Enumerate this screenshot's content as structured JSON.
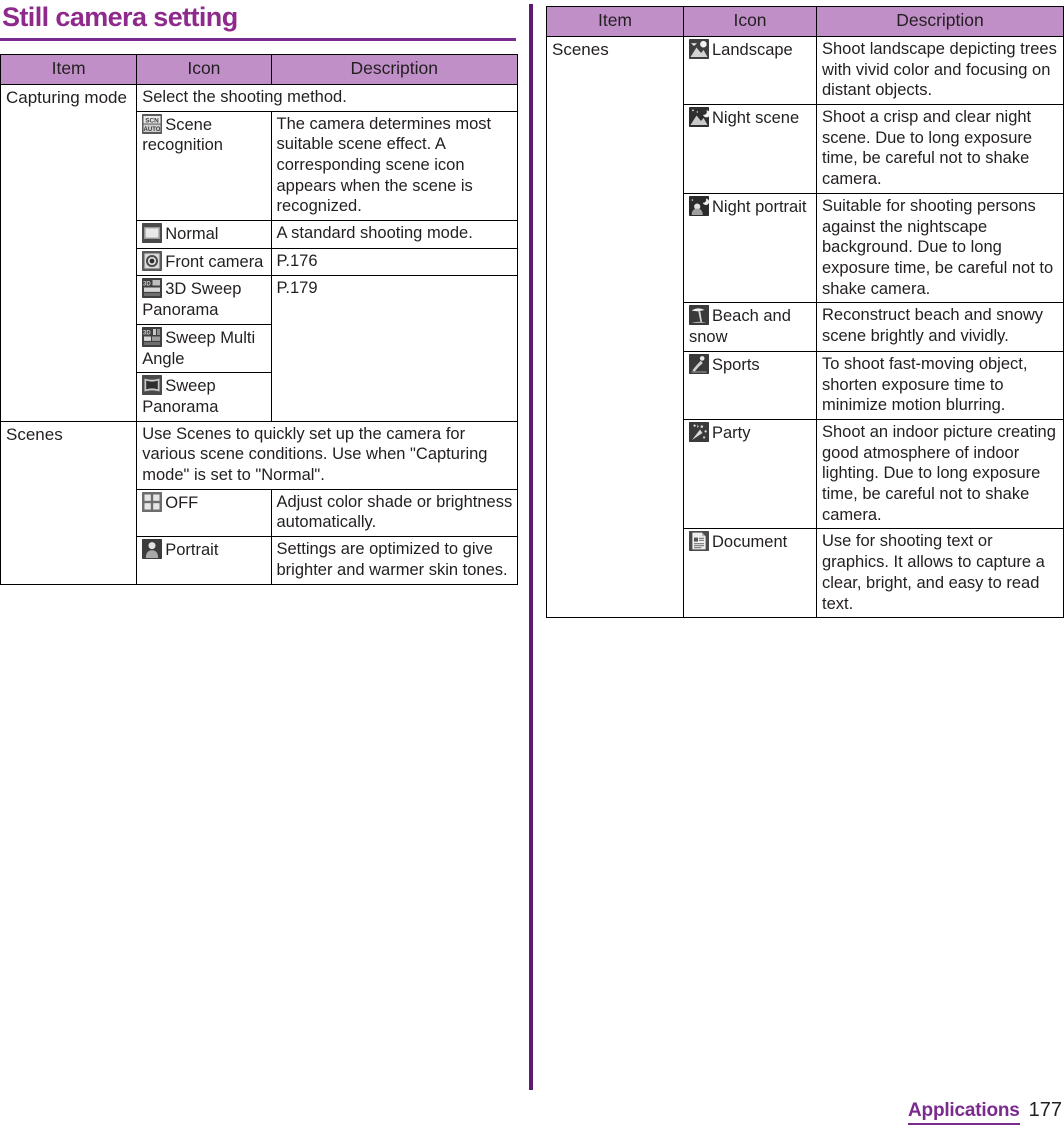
{
  "page": {
    "title": "Still camera setting",
    "footer_section": "Applications",
    "footer_page": "177",
    "accent_color": "#8e2a8b",
    "header_fill": "#c08fc8",
    "rule_color": "#5c1a70"
  },
  "left_table": {
    "headers": [
      "Item",
      "Icon",
      "Description"
    ],
    "rows": [
      {
        "item": "Capturing mode",
        "intro": "Select the shooting method.",
        "entries": [
          {
            "icon_name": "scene-recognition-icon",
            "icon_label": "Scene recognition",
            "description": "The camera determines most suitable scene effect. A corresponding scene icon appears when the scene is recognized."
          },
          {
            "icon_name": "normal-mode-icon",
            "icon_label": "Normal",
            "description": "A standard shooting mode."
          },
          {
            "icon_name": "front-camera-icon",
            "icon_label": "Front camera",
            "description": "P.176"
          },
          {
            "icon_name": "3d-sweep-panorama-icon",
            "icon_label": "3D Sweep Panorama",
            "description": "P.179"
          },
          {
            "icon_name": "sweep-multi-angle-icon",
            "icon_label": "Sweep Multi Angle",
            "description": ""
          },
          {
            "icon_name": "sweep-panorama-icon",
            "icon_label": "Sweep Panorama",
            "description": ""
          }
        ]
      },
      {
        "item": "Scenes",
        "intro": "Use Scenes to quickly set up the camera for various scene conditions. Use when \"Capturing mode\" is set to \"Normal\".",
        "entries": [
          {
            "icon_name": "scenes-off-icon",
            "icon_label": "OFF",
            "description": "Adjust color shade or brightness automatically."
          },
          {
            "icon_name": "portrait-icon",
            "icon_label": "Portrait",
            "description": "Settings are optimized to give brighter and warmer skin tones."
          }
        ]
      }
    ]
  },
  "right_table": {
    "headers": [
      "Item",
      "Icon",
      "Description"
    ],
    "item": "Scenes",
    "entries": [
      {
        "icon_name": "landscape-icon",
        "icon_label": "Landscape",
        "description": "Shoot landscape depicting trees with vivid color and focusing on distant objects."
      },
      {
        "icon_name": "night-scene-icon",
        "icon_label": "Night scene",
        "description": "Shoot a crisp and clear night scene. Due to long exposure time, be careful not to shake camera."
      },
      {
        "icon_name": "night-portrait-icon",
        "icon_label": "Night portrait",
        "description": "Suitable for shooting persons against the nightscape background. Due to long exposure time, be careful not to shake camera."
      },
      {
        "icon_name": "beach-and-snow-icon",
        "icon_label": "Beach and snow",
        "description": "Reconstruct beach and snowy scene brightly and vividly."
      },
      {
        "icon_name": "sports-icon",
        "icon_label": "Sports",
        "description": "To shoot fast-moving object, shorten exposure time to minimize motion blurring."
      },
      {
        "icon_name": "party-icon",
        "icon_label": "Party",
        "description": "Shoot an indoor picture creating good atmosphere of indoor lighting. Due to long exposure time, be careful not to shake camera."
      },
      {
        "icon_name": "document-icon",
        "icon_label": "Document",
        "description": "Use for shooting text or graphics. It allows to capture a clear, bright, and easy to read text."
      }
    ]
  }
}
